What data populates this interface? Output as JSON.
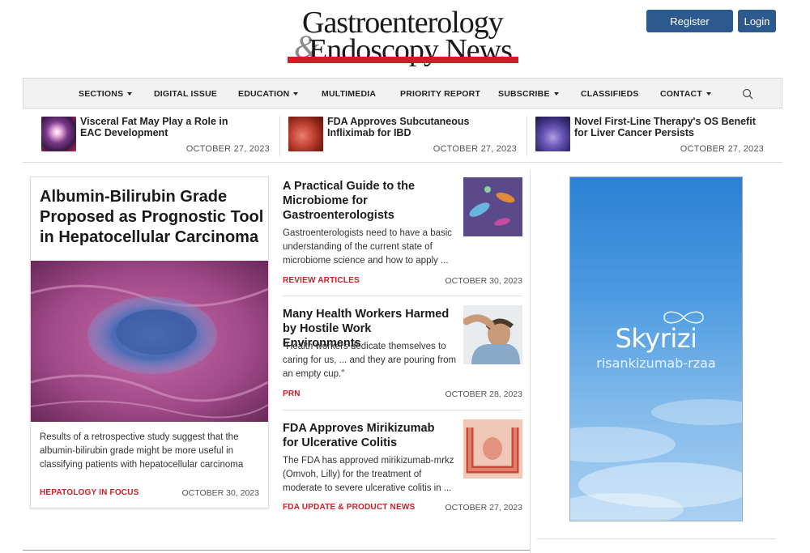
{
  "header": {
    "logo_line1": "Gastroenterology",
    "logo_amp": "&",
    "logo_line2": "Endoscopy News",
    "register_label": "Register",
    "login_label": "Login"
  },
  "nav": {
    "items": [
      {
        "label": "SECTIONS",
        "dropdown": true
      },
      {
        "label": "DIGITAL ISSUE",
        "dropdown": false
      },
      {
        "label": "EDUCATION",
        "dropdown": true
      },
      {
        "label": "MULTIMEDIA",
        "dropdown": false
      },
      {
        "label": "PRIORITY REPORT",
        "dropdown": false
      },
      {
        "label": "SUBSCRIBE",
        "dropdown": true
      },
      {
        "label": "CLASSIFIEDS",
        "dropdown": false
      },
      {
        "label": "CONTACT",
        "dropdown": true
      }
    ],
    "search_icon": "search-icon"
  },
  "top_strip": [
    {
      "title": "Visceral Fat May Play a Role in EAC Development",
      "date": "OCTOBER 27, 2023"
    },
    {
      "title": "FDA Approves Subcutaneous Infliximab for IBD",
      "date": "OCTOBER 27, 2023"
    },
    {
      "title": "Novel First-Line Therapy's OS Benefit for Liver Cancer Persists",
      "date": "OCTOBER 27, 2023"
    }
  ],
  "feature": {
    "title": "Albumin-Bilirubin Grade Proposed as Prognostic Tool in Hepatocellular Carcinoma",
    "description": "Results of a retrospective study suggest that the albumin-bilirubin grade might be more useful in classifying patients with hepatocellular carcinoma",
    "category": "HEPATOLOGY IN FOCUS",
    "date": "OCTOBER 30, 2023"
  },
  "articles": [
    {
      "title": "A Practical Guide to the Microbiome for Gastroenterologists",
      "description": "Gastroenterologists need to have a basic understanding of the current state of microbiome science and how to apply ...",
      "category": "REVIEW ARTICLES",
      "date": "OCTOBER 30, 2023"
    },
    {
      "title": "Many Health Workers Harmed by Hostile Work Environments",
      "description": "\"Health workers dedicate themselves to caring for us, ... and they are pouring from an empty cup.\"",
      "category": "PRN",
      "date": "OCTOBER 28, 2023"
    },
    {
      "title": "FDA Approves Mirikizumab for Ulcerative Colitis",
      "description": "The FDA has approved mirikizumab-mrkz (Omvoh, Lilly) for the treatment of moderate to severe ulcerative colitis in ...",
      "category": "FDA UPDATE & PRODUCT NEWS",
      "date": "OCTOBER 27, 2023"
    }
  ],
  "ad": {
    "brand": "Skyrizi",
    "generic_name": "risankizumab-rzaa"
  },
  "colors": {
    "accent_red": "#d01c24",
    "button_blue": "#2d5a8e"
  }
}
